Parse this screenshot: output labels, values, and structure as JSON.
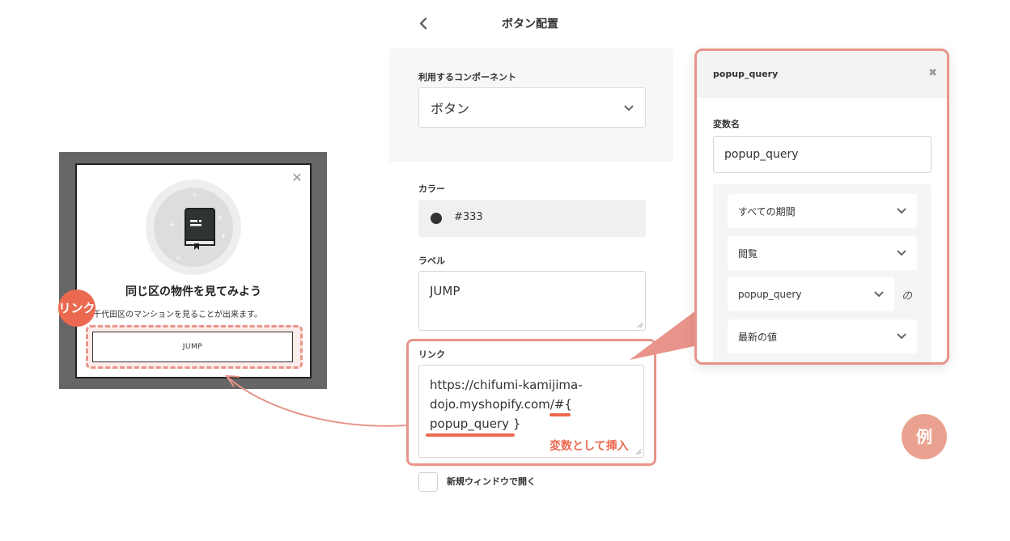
{
  "header": {
    "title": "ボタン配置"
  },
  "component": {
    "label": "利用するコンポーネント",
    "value": "ボタン"
  },
  "color": {
    "label": "カラー",
    "value": "#333",
    "swatch": "#333333"
  },
  "button_label": {
    "label": "ラベル",
    "value": "JUMP"
  },
  "link": {
    "label": "リンク",
    "lines": [
      "https://chifumi-kamijima-",
      "dojo.myshopify.com/#{",
      "popup_query }"
    ],
    "note": "変数として挿入"
  },
  "new_window": {
    "label": "新規ウィンドウで開く",
    "checked": false
  },
  "preview": {
    "title": "同じ区の物件を見てみよう",
    "description": "千代田区のマンションを見ることが出来ます。",
    "button": "JUMP",
    "badge": "リンク",
    "close_icon": "close-icon",
    "illustration_icon": "book-icon"
  },
  "variable_panel": {
    "title": "popup_query",
    "var_label": "変数名",
    "var_value": "popup_query",
    "selects": [
      "すべての期間",
      "閲覧",
      "popup_query",
      "最新の値"
    ],
    "connector": "の"
  },
  "example_badge": "例",
  "colors": {
    "accent": "#ea6950",
    "highlight": "#e8948a",
    "badge": "#eba18f",
    "text": "#333333"
  }
}
